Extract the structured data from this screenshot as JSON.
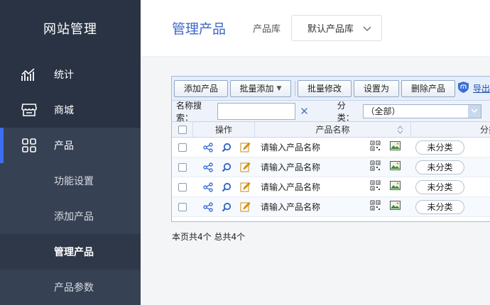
{
  "sidebar": {
    "brand": "网站管理",
    "items": [
      {
        "label": "统计",
        "icon": "chart-icon"
      },
      {
        "label": "商城",
        "icon": "store-icon"
      },
      {
        "label": "产品",
        "icon": "grid-icon"
      }
    ],
    "subitems": [
      {
        "label": "功能设置"
      },
      {
        "label": "添加产品"
      },
      {
        "label": "管理产品"
      },
      {
        "label": "产品参数"
      }
    ]
  },
  "header": {
    "title": "管理产品",
    "lib_label": "产品库",
    "lib_value": "默认产品库"
  },
  "toolbar": {
    "add": "添加产品",
    "batch_add": "批量添加",
    "batch_edit": "批量修改",
    "set_as": "设置为",
    "delete": "删除产品",
    "export": "导出"
  },
  "filter": {
    "search_label": "名称搜索：",
    "search_value": "",
    "category_label": "分类：",
    "category_value": "（全部）"
  },
  "table": {
    "headers": {
      "ops": "操作",
      "name": "产品名称",
      "category": "分类"
    },
    "rows": [
      {
        "name": "请输入产品名称",
        "category": "未分类"
      },
      {
        "name": "请输入产品名称",
        "category": "未分类"
      },
      {
        "name": "请输入产品名称",
        "category": "未分类"
      },
      {
        "name": "请输入产品名称",
        "category": "未分类"
      }
    ]
  },
  "footer": {
    "page_info": "本页共4个 总共4个"
  },
  "colors": {
    "sidebar_bg": "#2a3344",
    "accent": "#3d6ef0",
    "title": "#3e67c8"
  }
}
